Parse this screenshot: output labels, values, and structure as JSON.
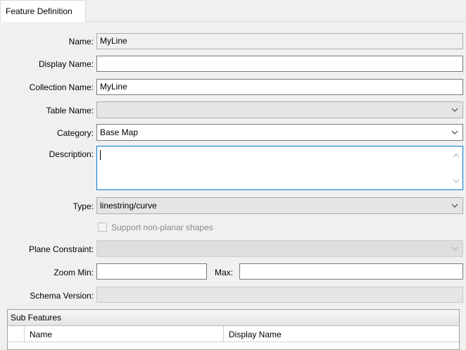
{
  "tabs": [
    {
      "label": "Feature Definition"
    }
  ],
  "form": {
    "name_label": "Name:",
    "name_value": "MyLine",
    "display_name_label": "Display Name:",
    "display_name_value": "",
    "collection_name_label": "Collection Name:",
    "collection_name_value": "MyLine",
    "table_name_label": "Table Name:",
    "table_name_value": "",
    "category_label": "Category:",
    "category_value": "Base Map",
    "description_label": "Description:",
    "description_value": "",
    "type_label": "Type:",
    "type_value": "linestring/curve",
    "support_nonplanar_label": "Support non-planar shapes",
    "support_nonplanar_checked": false,
    "plane_constraint_label": "Plane Constraint:",
    "plane_constraint_value": "",
    "zoom_min_label": "Zoom Min:",
    "zoom_min_value": "",
    "zoom_max_label": "Max:",
    "zoom_max_value": "",
    "schema_version_label": "Schema Version:",
    "schema_version_value": ""
  },
  "sub_features": {
    "title": "Sub Features",
    "columns": [
      "Name",
      "Display Name"
    ]
  },
  "colors": {
    "focus_border": "#0078d7",
    "panel_bg": "#f0f0f0"
  }
}
